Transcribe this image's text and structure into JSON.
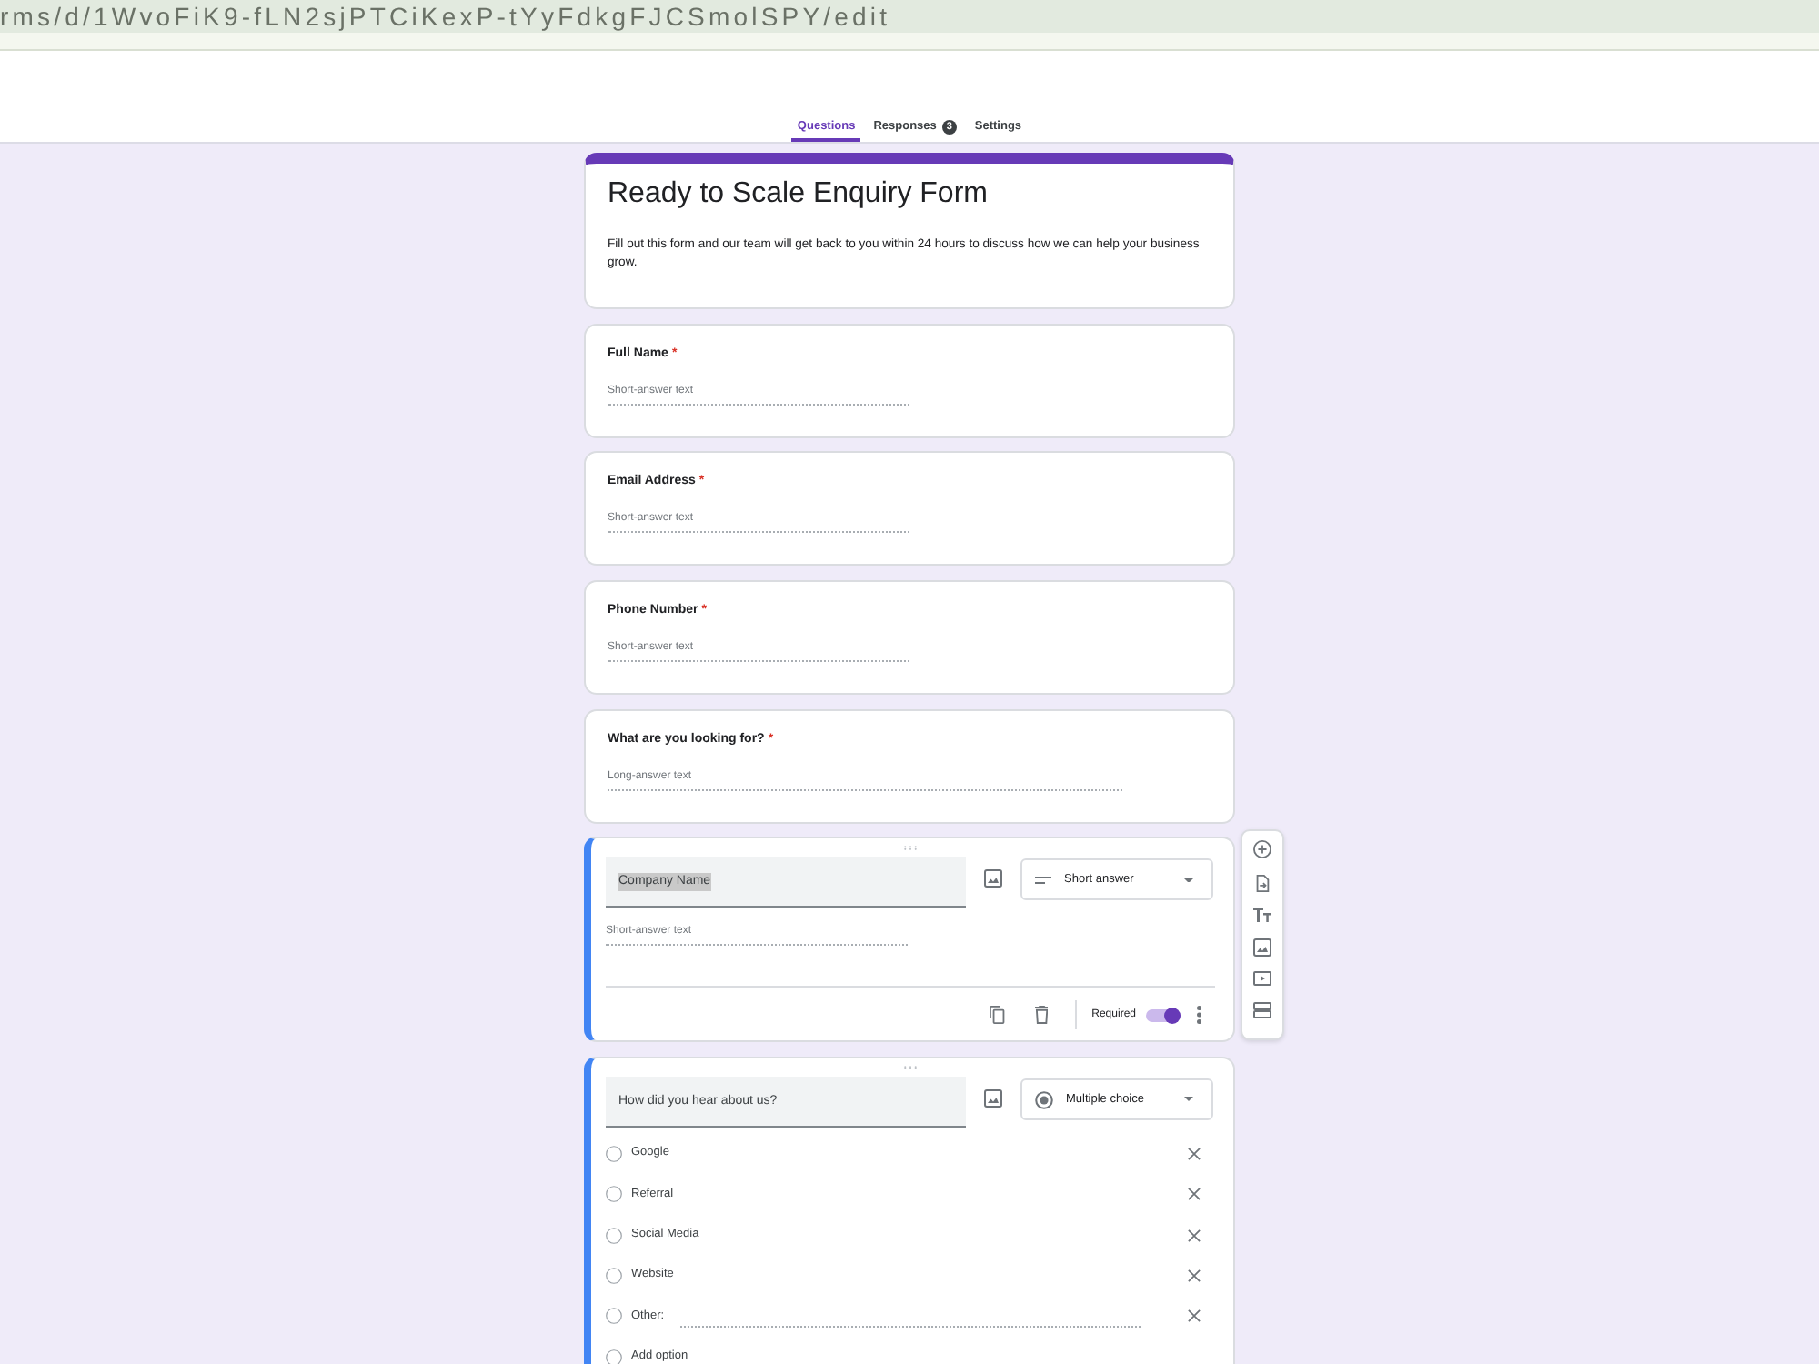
{
  "address_bar": {
    "url": "rms/d/1WvoFiK9-fLN2sjPTCiKexP-tYyFdkgFJCSmolSPY/edit"
  },
  "tabs": [
    {
      "label": "Questions",
      "selected": true
    },
    {
      "label": "Responses",
      "selected": false,
      "badge": "3"
    },
    {
      "label": "Settings",
      "selected": false
    }
  ],
  "form": {
    "title": "Ready to Scale Enquiry Form",
    "description": "Fill out this form and our team will get back to you within 24 hours to discuss how we can help your business grow."
  },
  "questions": [
    {
      "kind": "short_preview",
      "title": "Full Name",
      "required_mark": "*",
      "answer_hint": "Short-answer text"
    },
    {
      "kind": "short_preview",
      "title": "Email Address",
      "required_mark": "*",
      "answer_hint": "Short-answer text"
    },
    {
      "kind": "short_preview",
      "title": "Phone Number",
      "required_mark": "*",
      "answer_hint": "Short-answer text"
    },
    {
      "kind": "long_preview",
      "title": "What are you looking for?",
      "required_mark": "*",
      "answer_hint": "Long-answer text"
    },
    {
      "kind": "short_editor",
      "title": "Company Name",
      "title_selected": true,
      "type_label": "Short answer",
      "answer_hint": "Short-answer text",
      "required": {
        "label": "Required",
        "on": true
      }
    },
    {
      "kind": "choice_editor",
      "title": "How did you hear about us?",
      "title_selected": false,
      "type_label": "Multiple choice",
      "options": [
        {
          "kind": "option",
          "label": "Google"
        },
        {
          "kind": "option",
          "label": "Referral"
        },
        {
          "kind": "option",
          "label": "Social Media"
        },
        {
          "kind": "option",
          "label": "Website"
        },
        {
          "kind": "other",
          "label": "Other:"
        }
      ],
      "add_option": "Add option"
    }
  ]
}
